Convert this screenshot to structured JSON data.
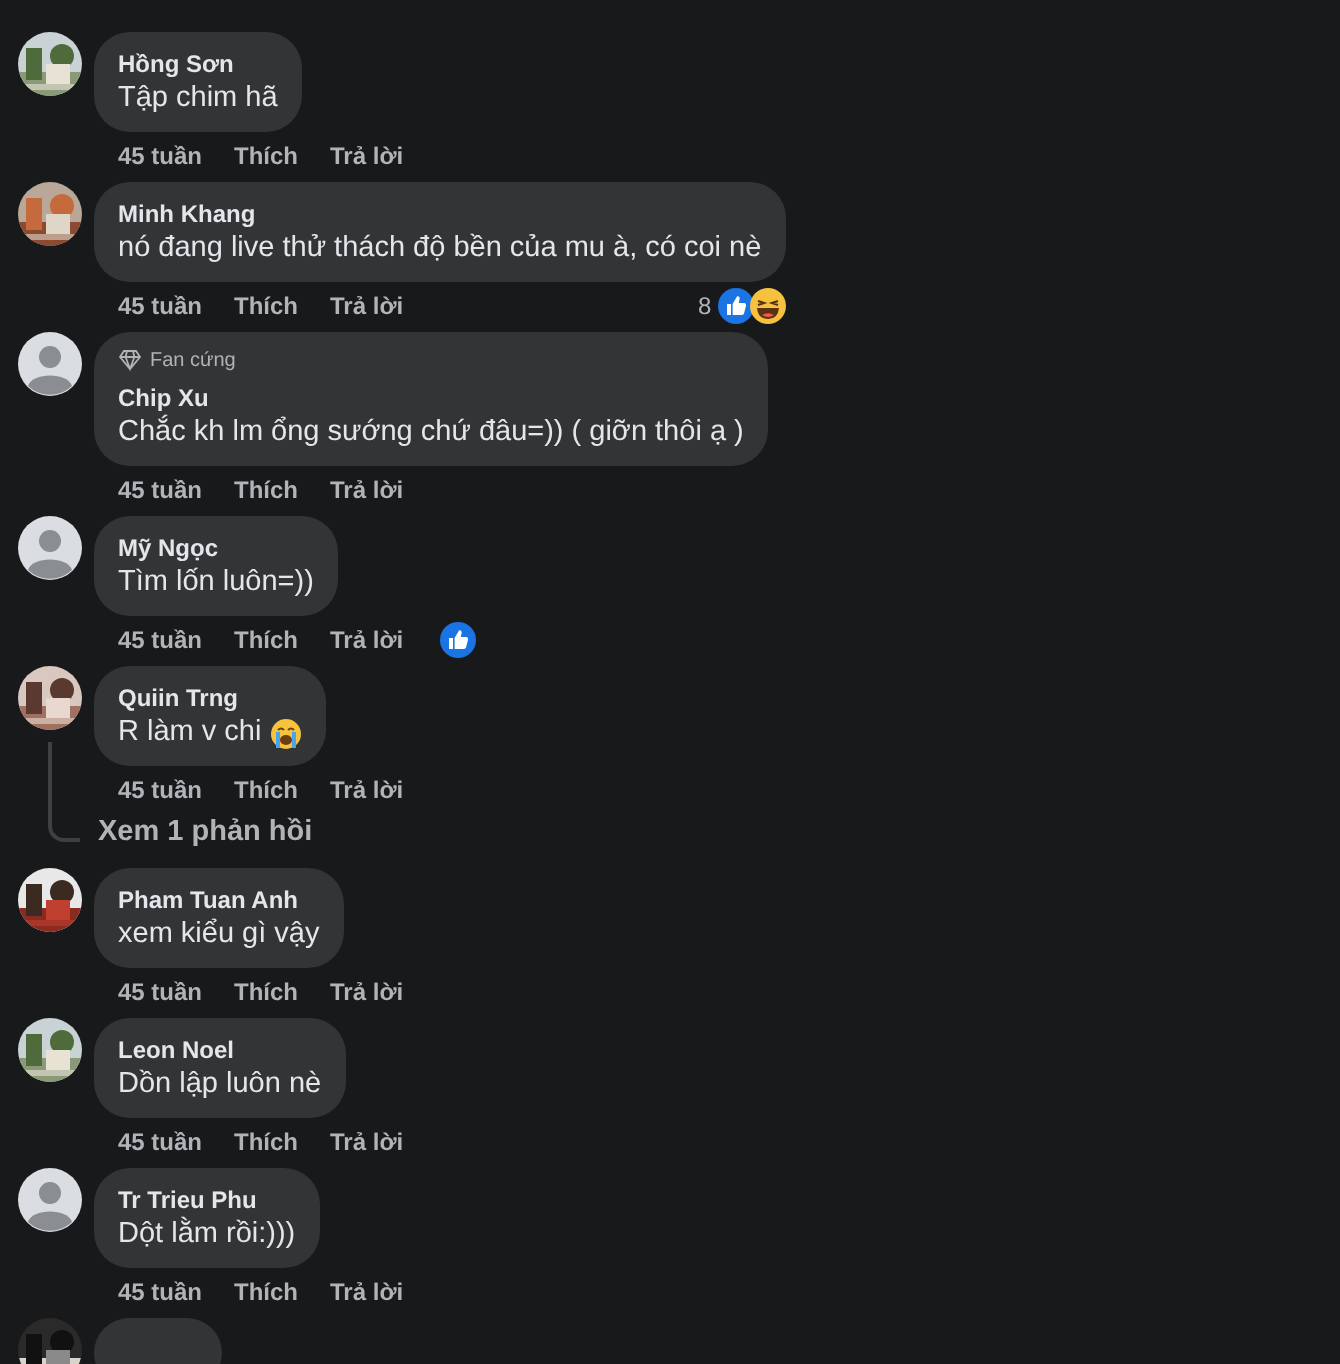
{
  "comments": [
    {
      "avatar": {
        "kind": "picture"
      },
      "name": "Hồng Sơn",
      "text": "Tập chim hã",
      "has_emoji": false,
      "time": "45 tuần",
      "like": "Thích",
      "reply": "Trả lời"
    },
    {
      "avatar": {
        "kind": "picture"
      },
      "name": "Minh Khang",
      "text": "nó đang live thử thách độ bền của mu à, có coi nè",
      "has_emoji": false,
      "time": "45 tuần",
      "like": "Thích",
      "reply": "Trả lời",
      "reactions": {
        "count": "8",
        "types": [
          {
            "kind": "like"
          },
          {
            "kind": "haha"
          }
        ]
      }
    },
    {
      "avatar": {
        "kind": "default"
      },
      "badge": "Fan cứng",
      "name": "Chip Xu",
      "text": "Chắc kh lm ổng sướng chứ đâu=)) ( giỡn thôi ạ )",
      "has_emoji": false,
      "time": "45 tuần",
      "like": "Thích",
      "reply": "Trả lời"
    },
    {
      "avatar": {
        "kind": "default"
      },
      "name": "Mỹ Ngọc",
      "text": "Tìm lốn luôn=))",
      "has_emoji": false,
      "time": "45 tuần",
      "like": "Thích",
      "reply": "Trả lời",
      "reactions": {
        "types": [
          {
            "kind": "like"
          }
        ]
      }
    },
    {
      "avatar": {
        "kind": "picture"
      },
      "name": "Quiin Trng",
      "text": "R làm v chi",
      "has_emoji": true,
      "time": "45 tuần",
      "like": "Thích",
      "reply": "Trả lời",
      "replies_link": "Xem 1 phản hồi"
    },
    {
      "avatar": {
        "kind": "picture"
      },
      "name": "Pham Tuan Anh",
      "text": "xem kiểu gì vậy",
      "has_emoji": false,
      "time": "45 tuần",
      "like": "Thích",
      "reply": "Trả lời"
    },
    {
      "avatar": {
        "kind": "picture"
      },
      "name": "Leon Noel",
      "text": "Dồn lập luôn nè",
      "has_emoji": false,
      "time": "45 tuần",
      "like": "Thích",
      "reply": "Trả lời"
    },
    {
      "avatar": {
        "kind": "default"
      },
      "name": "Tr Trieu Phu",
      "text": "Dột lằm rồi:)))",
      "has_emoji": false,
      "time": "45 tuần",
      "like": "Thích",
      "reply": "Trả lời"
    },
    {
      "avatar": {
        "kind": "picture"
      }
    }
  ]
}
